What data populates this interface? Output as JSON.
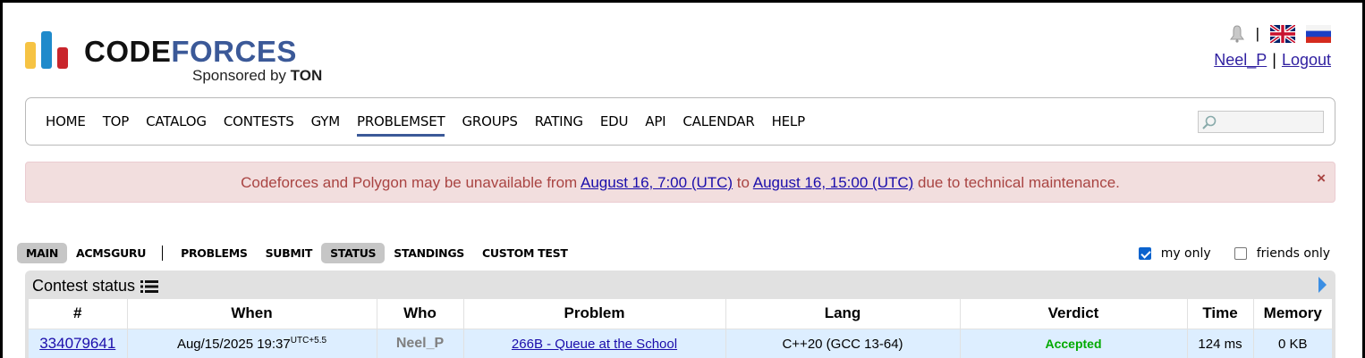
{
  "header": {
    "logo_word_1": "CODE",
    "logo_word_2": "FORCES",
    "logo_sponsor_prefix": "Sponsored by ",
    "logo_sponsor_name": "TON",
    "lang_separator": "|",
    "user_name": "Neel_P",
    "user_separator": "|",
    "logout_label": "Logout"
  },
  "nav": {
    "items": [
      {
        "label": "HOME"
      },
      {
        "label": "TOP"
      },
      {
        "label": "CATALOG"
      },
      {
        "label": "CONTESTS"
      },
      {
        "label": "GYM"
      },
      {
        "label": "PROBLEMSET",
        "active": true
      },
      {
        "label": "GROUPS"
      },
      {
        "label": "RATING"
      },
      {
        "label": "EDU"
      },
      {
        "label": "API"
      },
      {
        "label": "CALENDAR"
      },
      {
        "label": "HELP"
      }
    ],
    "search_placeholder": ""
  },
  "alert": {
    "text_1": "Codeforces and Polygon may be unavailable from ",
    "link_1": "August 16, 7:00 (UTC)",
    "text_2": " to ",
    "link_2": "August 16, 15:00 (UTC)",
    "text_3": " due to technical maintenance.",
    "close": "×"
  },
  "submenu": {
    "items": [
      "MAIN",
      "ACMSGURU",
      "PROBLEMS",
      "SUBMIT",
      "STATUS",
      "STANDINGS",
      "CUSTOM TEST"
    ],
    "selected": [
      "MAIN",
      "STATUS"
    ]
  },
  "filters": {
    "my_only_label": "my only",
    "my_only_checked": true,
    "friends_only_label": "friends only",
    "friends_only_checked": false
  },
  "status": {
    "title": "Contest status",
    "columns": [
      "#",
      "When",
      "Who",
      "Problem",
      "Lang",
      "Verdict",
      "Time",
      "Memory"
    ],
    "rows": [
      {
        "id": "334079641",
        "when": "Aug/15/2025 19:37",
        "tz": "UTC+5.5",
        "who": "Neel_P",
        "problem": "266B - Queue at the School",
        "lang": "C++20 (GCC 13-64)",
        "verdict": "Accepted",
        "time": "124 ms",
        "memory": "0 KB"
      }
    ]
  },
  "colors": {
    "accent": "#3b5998",
    "alert_bg": "#f2dede",
    "alert_text": "#a94442",
    "accepted": "#00aa00",
    "row_bg": "#ddeeff"
  }
}
